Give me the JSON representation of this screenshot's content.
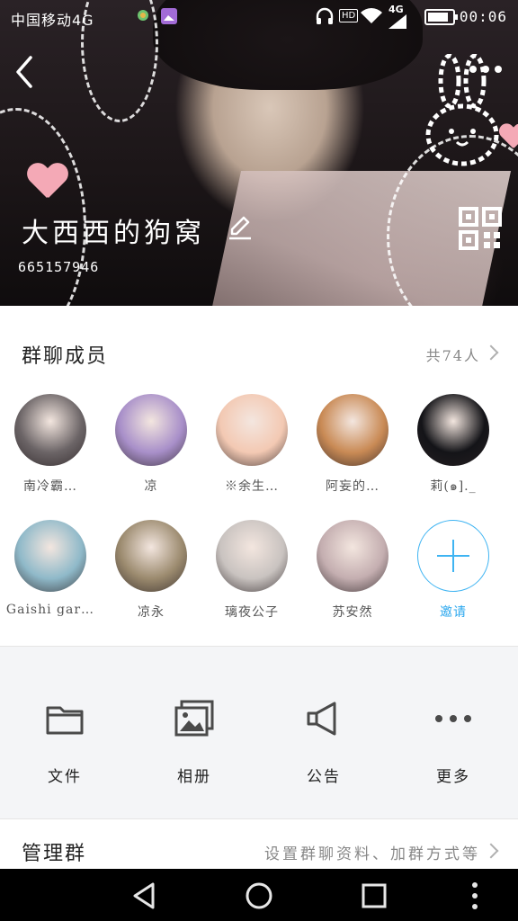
{
  "status_bar": {
    "carrier": "中国移动4G",
    "network": "4G",
    "hd": "HD",
    "time": "00:06"
  },
  "hero": {
    "title": "大西西的狗窝",
    "id": "665157946"
  },
  "members": {
    "title": "群聊成员",
    "count": "共74人",
    "list": [
      {
        "name": "南冷霸…",
        "color": "#6b6466"
      },
      {
        "name": "凉",
        "color": "#a88fc9"
      },
      {
        "name": "※余生…",
        "color": "#f3c9b3"
      },
      {
        "name": "阿妄的…",
        "color": "#c98a55"
      },
      {
        "name": "莉(๑]._",
        "color": "#141418"
      },
      {
        "name": "Gaishi gar…",
        "color": "#8fb9c9"
      },
      {
        "name": "凉永",
        "color": "#9b8a6e"
      },
      {
        "name": "璃夜公子",
        "color": "#c9c3c0"
      },
      {
        "name": "苏安然",
        "color": "#c4aeb0"
      }
    ],
    "invite": "邀请"
  },
  "tools": [
    {
      "label": "文件",
      "icon": "folder-icon"
    },
    {
      "label": "相册",
      "icon": "album-icon"
    },
    {
      "label": "公告",
      "icon": "megaphone-icon"
    },
    {
      "label": "更多",
      "icon": "more-dots-icon"
    }
  ],
  "manage": {
    "title": "管理群",
    "desc": "设置群聊资料、加群方式等"
  },
  "colors": {
    "accent": "#2aa7ee",
    "tools_bg": "#f4f5f7"
  }
}
